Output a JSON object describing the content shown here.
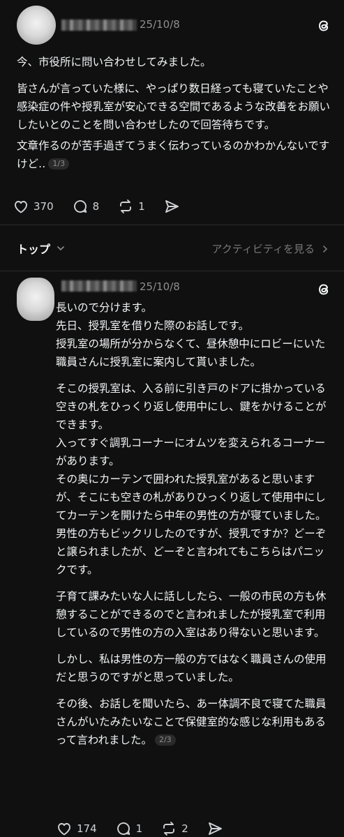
{
  "post1": {
    "date": "25/10/8",
    "paragraphs": [
      "今、市役所に問い合わせしてみました。",
      "皆さんが言っていた様に、やっぱり数日経っても寝ていたことや感染症の件や授乳室が安心できる空間であるような改善をお願いしたいとのことを問い合わせしたので回答待ちです。",
      "文章作るのが苦手過ぎてうまく伝わっているのかわかんないですけど‥"
    ],
    "page_badge": "1/3",
    "likes": "370",
    "replies": "8",
    "reposts": "1"
  },
  "sort_bar": {
    "left_label": "トップ",
    "right_label": "アクティビティを見る"
  },
  "post2": {
    "date": "25/10/8",
    "paragraphs": [
      "長いので分けます。",
      "先日、授乳室を借りた際のお話しです。",
      "授乳室の場所が分からなくて、昼休憩中にロビーにいた職員さんに授乳室に案内して貰いました。",
      "そこの授乳室は、入る前に引き戸のドアに掛かっている空きの札をひっくり返し使用中にし、鍵をかけることができます。",
      "入ってすぐ調乳コーナーにオムツを変えられるコーナーがあります。",
      "その奥にカーテンで囲われた授乳室があると思いますが、そこにも空きの札がありひっくり返して使用中にしてカーテンを開けたら中年の男性の方が寝ていました。",
      "男性の方もビックリしたのですが、授乳ですか？どーぞと譲られましたが、どーぞと言われてもこちらはパニックです。",
      "子育て課みたいな人に話ししたら、一般の市民の方も休憩することができるのでと言われましたが授乳室で利用しているので男性の方の入室はあり得ないと思います。",
      "しかし、私は男性の方一般の方ではなく職員さんの使用だと思うのですがと思っていました。",
      "その後、お話しを聞いたら、あー体調不良で寝てた職員さんがいたみたいなことで保健室的な感じな利用もあるって言われました。"
    ],
    "page_badge": "2/3",
    "likes": "174",
    "replies": "1",
    "reposts": "2"
  },
  "icons": {
    "logo": "threads-logo-icon",
    "like": "heart-icon",
    "reply": "comment-icon",
    "repost": "repost-icon",
    "share": "share-icon",
    "chevron_down": "chevron-down-icon",
    "chevron_right": "chevron-right-icon"
  }
}
